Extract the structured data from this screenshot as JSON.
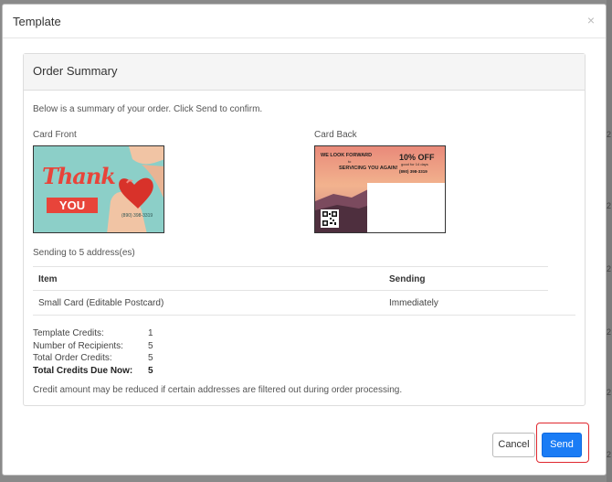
{
  "modal": {
    "title": "Template",
    "close_glyph": "×"
  },
  "summary": {
    "title": "Order Summary",
    "intro": "Below is a summary of your order. Click Send to confirm.",
    "card_front_label": "Card Front",
    "card_back_label": "Card Back",
    "sending_to": "Sending to 5 address(es)",
    "table": {
      "headers": [
        "Item",
        "Sending"
      ],
      "rows": [
        [
          "Small Card (Editable Postcard)",
          "Immediately"
        ]
      ]
    },
    "credits": [
      {
        "label": "Template Credits:",
        "value": "1"
      },
      {
        "label": "Number of Recipients:",
        "value": "5"
      },
      {
        "label": "Total Order Credits:",
        "value": "5"
      },
      {
        "label": "Total Credits Due Now:",
        "value": "5"
      }
    ],
    "note": "Credit amount may be reduced if certain addresses are filtered out during order processing."
  },
  "front_card": {
    "thank": "Thank",
    "you": "YOU",
    "phone": "(890) 398-3319",
    "colors": {
      "bg": "#8ccfc8",
      "accent": "#e8443a",
      "heart": "#d8322a"
    }
  },
  "back_card": {
    "line1": "WE LOOK FORWARD",
    "to": "to",
    "line2": "SERVICING YOU AGAIN!",
    "off": "10% OFF",
    "good": "good for 14 days",
    "phone": "(890) 398-3319"
  },
  "buttons": {
    "cancel": "Cancel",
    "send": "Send"
  },
  "backdrop_chars": [
    "2",
    "2",
    "2",
    "2",
    "2",
    "2"
  ],
  "colors": {
    "primary": "#1a7cf5",
    "highlight": "#e0282f"
  }
}
